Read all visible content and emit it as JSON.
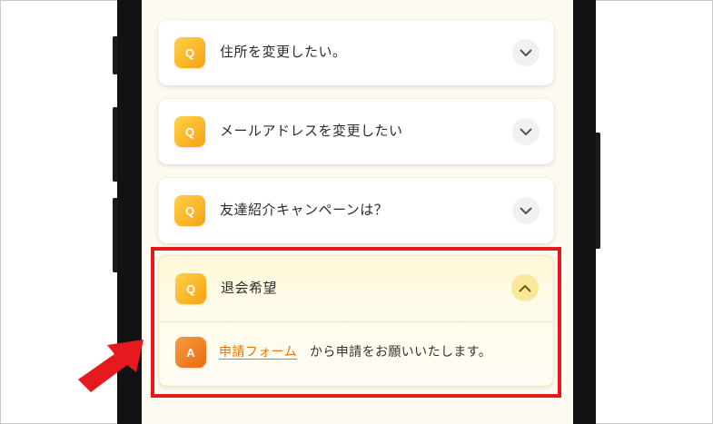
{
  "faq": {
    "items": [
      {
        "badge": "Q",
        "question": "住所を変更したい。",
        "expanded": false
      },
      {
        "badge": "Q",
        "question": "メールアドレスを変更したい",
        "expanded": false
      },
      {
        "badge": "Q",
        "question": "友達紹介キャンペーンは？",
        "expanded": false
      },
      {
        "badge": "Q",
        "question": "退会希望",
        "expanded": true,
        "answer": {
          "badge": "A",
          "link_text": "申請フォーム",
          "text": "から申請をお願いいたします。"
        }
      }
    ]
  },
  "icons": {
    "collapsed": "chevron-down-icon",
    "expanded": "chevron-up-icon",
    "callout": "red-arrow-icon"
  },
  "colors": {
    "accent_q": "#f6a312",
    "accent_a": "#eb6a12",
    "link": "#e07713",
    "highlight": "#e5191e"
  }
}
